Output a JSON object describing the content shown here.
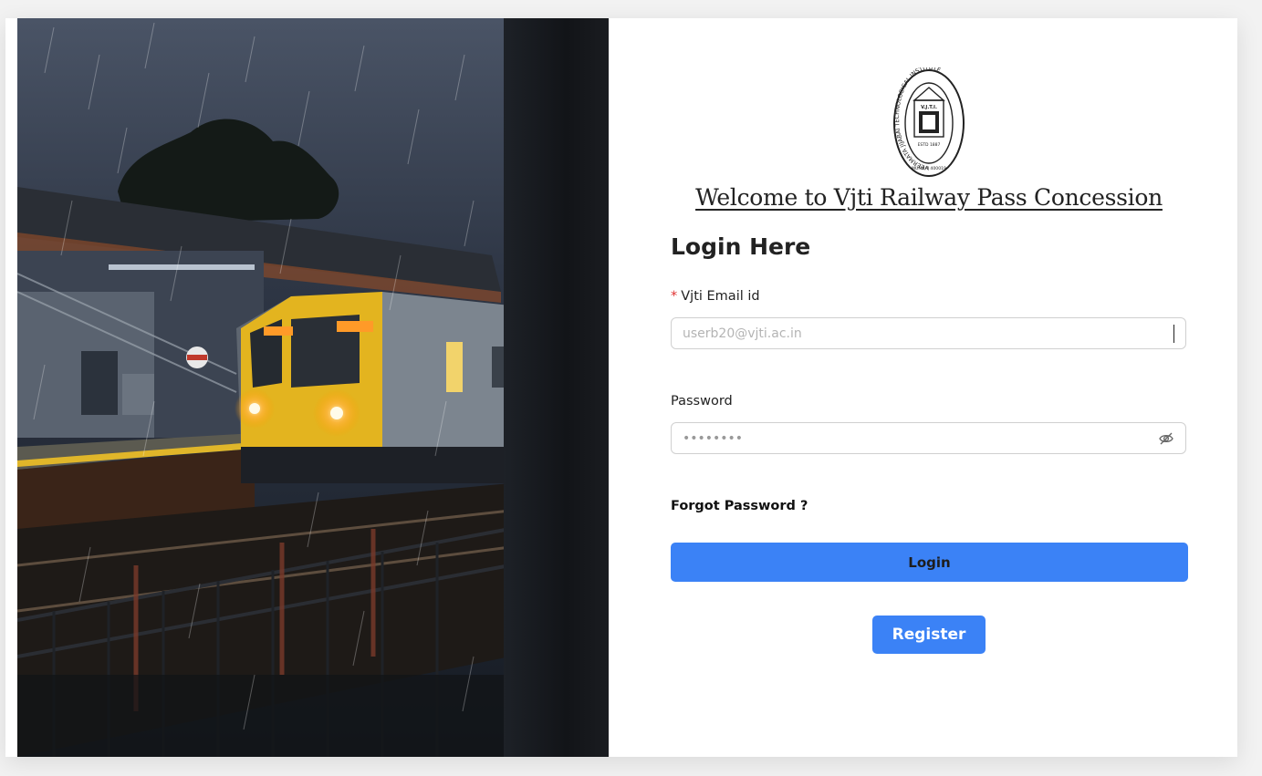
{
  "page": {
    "welcome_title": "Welcome to Vjti Railway Pass Concession",
    "heading": "Login Here"
  },
  "logo": {
    "ring_text": "VEERMATA JIJABAI TECHNOLOGICAL INSTITUTE",
    "inner_text": "V.J.T.I.",
    "established": "ESTD 1887",
    "city": "MUMBAI 400019"
  },
  "form": {
    "email": {
      "label": "Vjti Email id",
      "required_mark": "*",
      "placeholder": "userb20@vjti.ac.in",
      "value": ""
    },
    "password": {
      "label": "Password",
      "value": "12345678"
    },
    "forgot_label": "Forgot Password ?",
    "login_label": "Login",
    "register_label": "Register"
  },
  "icons": {
    "password_toggle": "eye-slash-icon"
  },
  "colors": {
    "primary_button": "#3b82f6",
    "required": "#e03131",
    "background": "#ffffff"
  }
}
